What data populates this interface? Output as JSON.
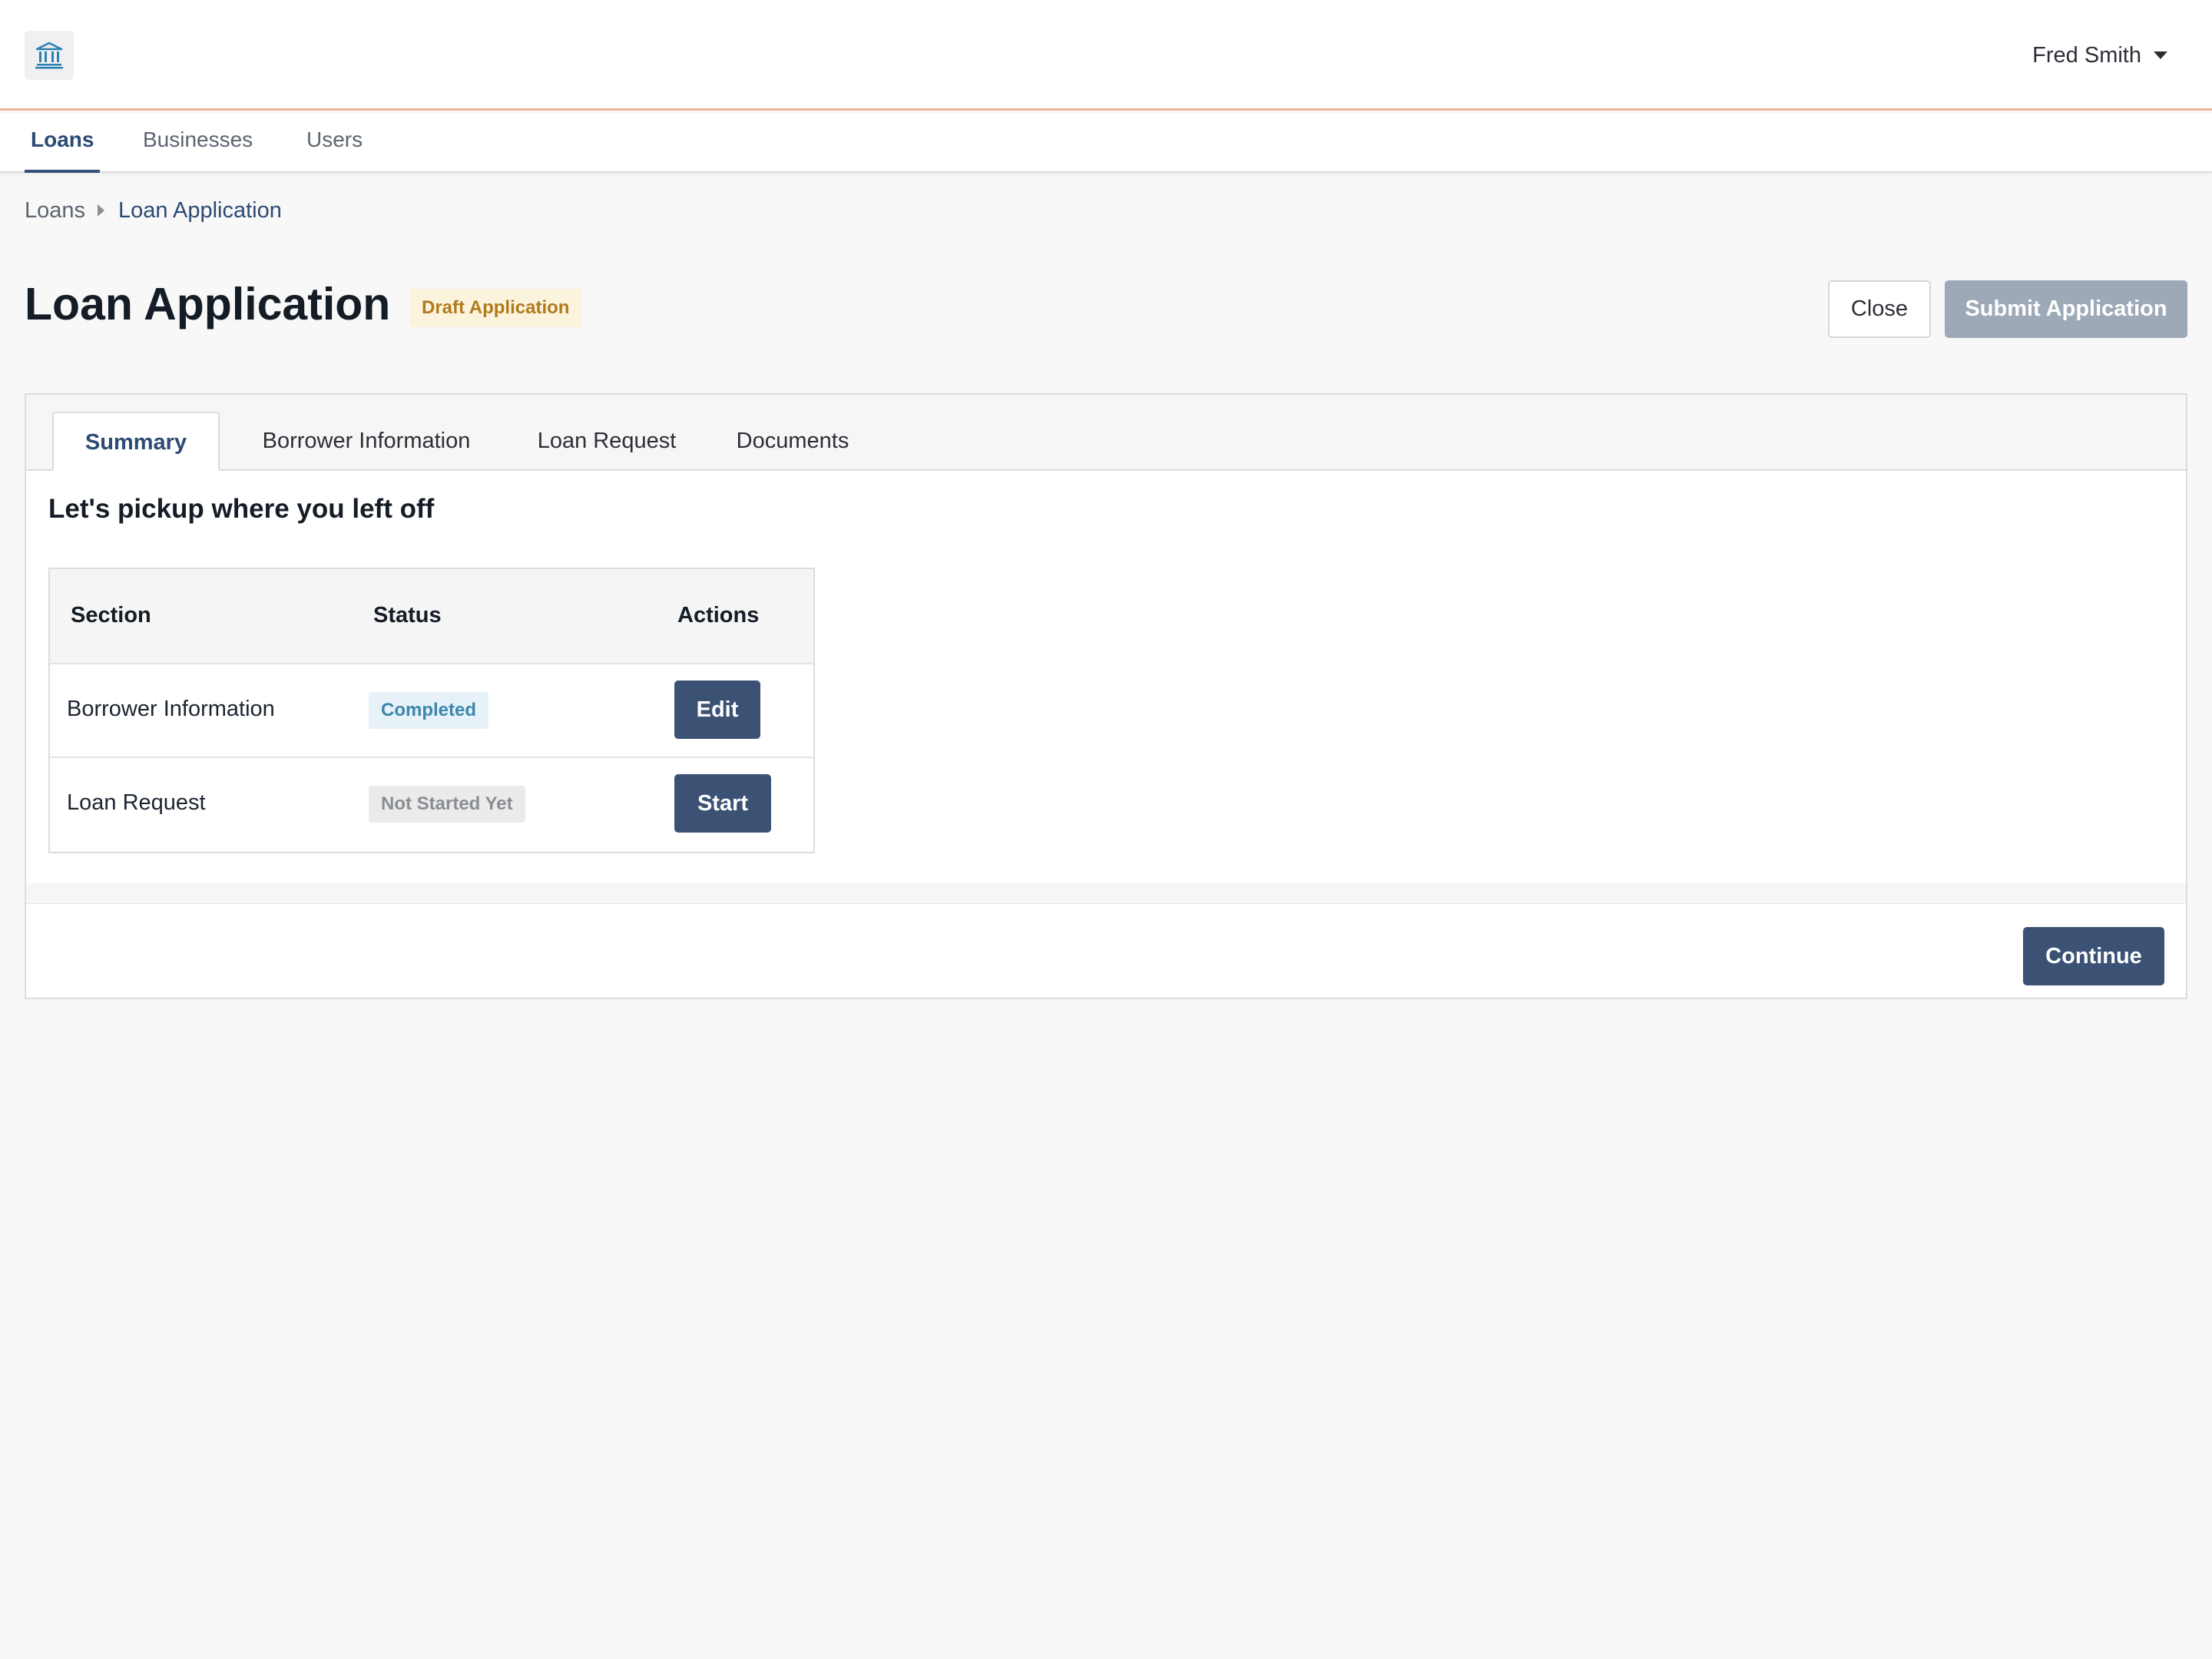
{
  "header": {
    "logo_icon": "bank-icon",
    "user_name": "Fred Smith"
  },
  "nav": {
    "items": [
      {
        "label": "Loans",
        "active": true
      },
      {
        "label": "Businesses",
        "active": false
      },
      {
        "label": "Users",
        "active": false
      }
    ]
  },
  "breadcrumb": {
    "root": "Loans",
    "current": "Loan Application"
  },
  "page": {
    "title": "Loan Application",
    "badge": "Draft Application",
    "close_label": "Close",
    "submit_label": "Submit Application"
  },
  "tabs": [
    {
      "label": "Summary",
      "active": true
    },
    {
      "label": "Borrower Information",
      "active": false
    },
    {
      "label": "Loan Request",
      "active": false
    },
    {
      "label": "Documents",
      "active": false
    }
  ],
  "summary": {
    "heading": "Let's pickup where you left off",
    "columns": [
      "Section",
      "Status",
      "Actions"
    ],
    "rows": [
      {
        "section": "Borrower Information",
        "status": "Completed",
        "action": "Edit"
      },
      {
        "section": "Loan Request",
        "status": "Not Started Yet",
        "action": "Start"
      }
    ],
    "continue_label": "Continue"
  },
  "colors": {
    "primary": "#3b5275",
    "accent_line": "#f0b69a",
    "draft_badge_bg": "#fcf3dc",
    "draft_badge_text": "#b07a1c",
    "completed_bg": "#e6f2f8",
    "completed_text": "#3d86ad"
  }
}
